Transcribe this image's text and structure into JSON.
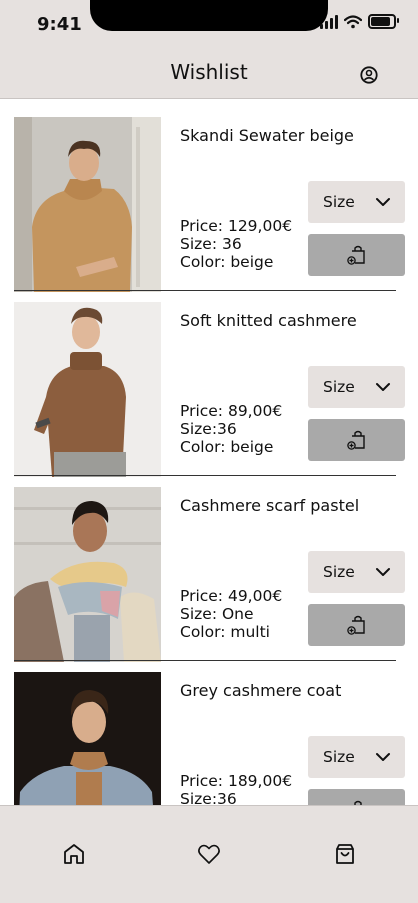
{
  "status_bar": {
    "time": "9:41"
  },
  "header": {
    "title": "Wishlist"
  },
  "colors": {
    "background": "#e6e1df",
    "select_bg": "#e6e1df",
    "add_btn_bg": "#a9a9a9",
    "text": "#111111"
  },
  "items": [
    {
      "name": "Skandi Sewater beige",
      "price": "Price: 129,00€",
      "size": "Size: 36",
      "color": "Color: beige",
      "size_label": "Size",
      "image": "man-beige-turtleneck-photo"
    },
    {
      "name": "Soft knitted cashmere",
      "price": "Price: 89,00€",
      "size": "Size:36",
      "color": "Color: beige",
      "size_label": "Size",
      "image": "man-brown-knit-photo"
    },
    {
      "name": "Cashmere scarf pastel",
      "price": "Price: 49,00€",
      "size": "Size: One",
      "color": "Color: multi",
      "size_label": "Size",
      "image": "man-pastel-scarf-photo"
    },
    {
      "name": "Grey cashmere coat",
      "price": "Price: 189,00€",
      "size": "Size:36",
      "color": "",
      "size_label": "Size",
      "image": "man-grey-coat-photo"
    }
  ],
  "icons": {
    "profile": "user-circle-icon",
    "chevron": "chevron-down-icon",
    "add_to_bag": "bag-plus-icon",
    "home": "home-icon",
    "wishlist": "heart-icon",
    "bag": "shopping-bag-icon"
  }
}
